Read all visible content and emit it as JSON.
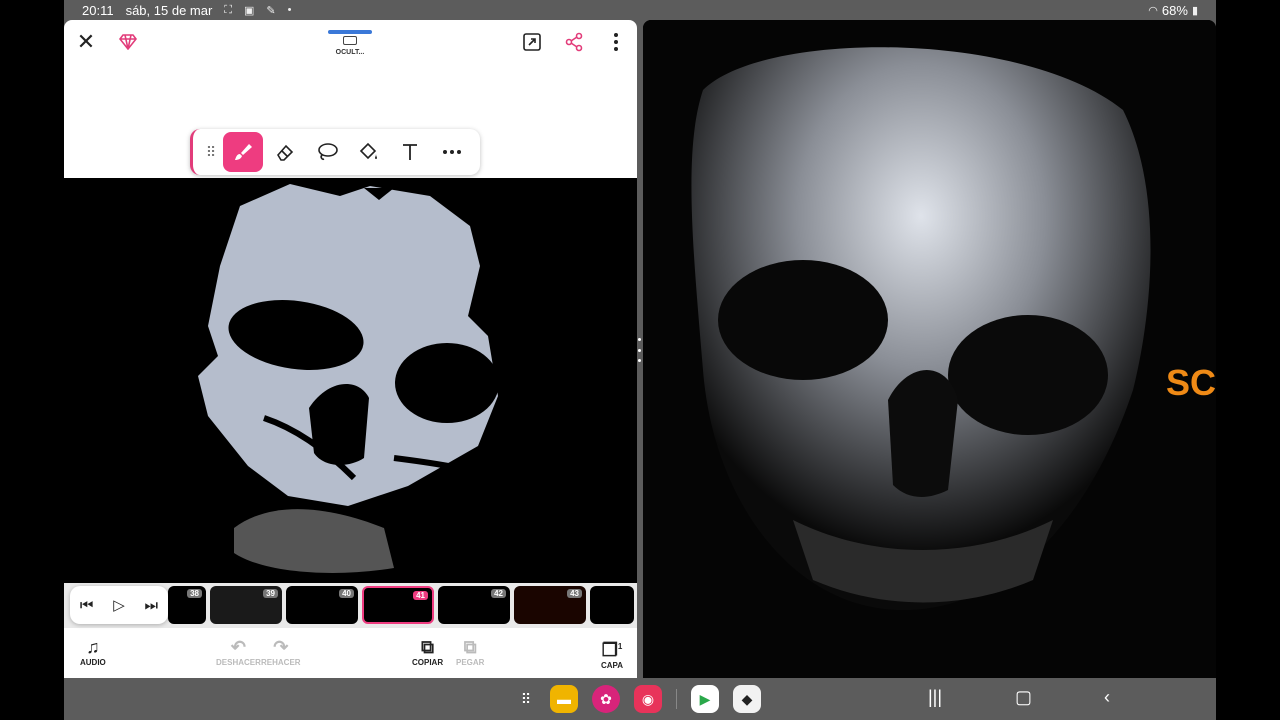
{
  "status_bar": {
    "time": "20:11",
    "date": "sáb, 15 de mar",
    "battery": "68%",
    "icons": [
      "screenshot-icon",
      "screen-record-icon",
      "pen-icon",
      "dot-icon",
      "wifi-icon",
      "battery-icon"
    ]
  },
  "top_bar": {
    "hide_label": "OCULT...",
    "icons": [
      "close-icon",
      "gem-icon",
      "expand-icon",
      "share-icon",
      "more-vertical-icon"
    ]
  },
  "toolbar": {
    "tools": [
      "drag-handle-icon",
      "brush-icon",
      "eraser-icon",
      "lasso-icon",
      "fill-bucket-icon",
      "text-icon",
      "more-horizontal-icon"
    ],
    "active_tool": "brush",
    "accent": "#ee3c80"
  },
  "timeline": {
    "controls": [
      "skip-back-icon",
      "play-icon",
      "skip-forward-icon"
    ],
    "frames": [
      {
        "number": "38"
      },
      {
        "number": "39"
      },
      {
        "number": "40"
      },
      {
        "number": "41",
        "active": true
      },
      {
        "number": "42"
      },
      {
        "number": "43"
      },
      {
        "number": ""
      }
    ]
  },
  "bottom_bar": {
    "audio": "AUDIO",
    "undo": "DESHACER",
    "redo": "REHACER",
    "copy": "COPIAR",
    "paste": "PEGAR",
    "layers": "CAPA",
    "layers_count": "1"
  },
  "right_panel": {
    "partial_text": "SC"
  },
  "dock": {
    "apps": [
      "apps-grid-icon",
      "files-icon",
      "flower-app-icon",
      "camera-app-icon",
      "play-store-icon",
      "roblox-icon"
    ]
  },
  "nav": {
    "buttons": [
      "recents-icon",
      "home-icon",
      "back-icon"
    ]
  }
}
